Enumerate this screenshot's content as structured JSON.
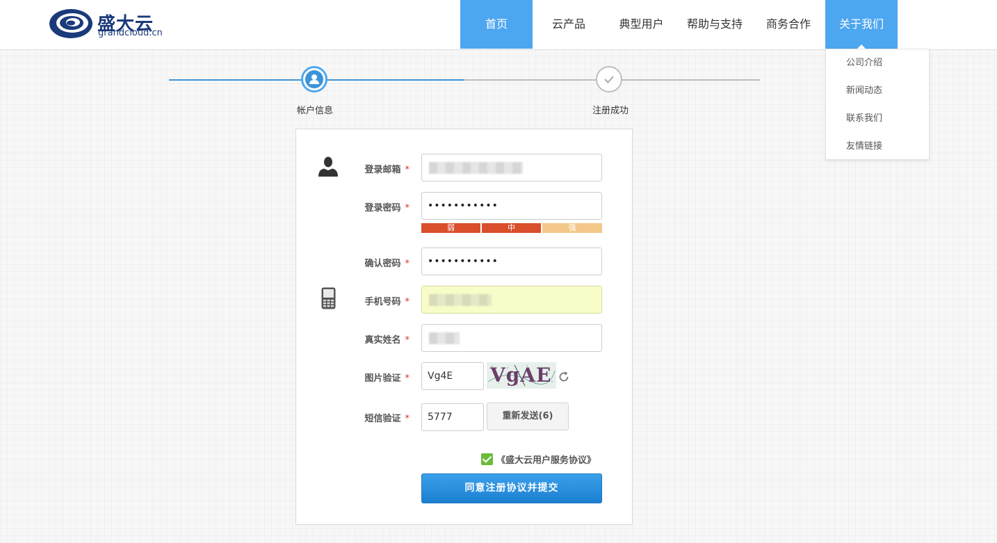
{
  "logo": {
    "title": "盛大云",
    "subtitle": "grandcloud.cn"
  },
  "nav": {
    "items": [
      "首页",
      "云产品",
      "典型用户",
      "帮助与支持",
      "商务合作",
      "关于我们"
    ],
    "active_color": "#4da6f0"
  },
  "dropdown": {
    "items": [
      "公司介绍",
      "新闻动态",
      "联系我们",
      "友情链接"
    ]
  },
  "steps": {
    "step1": "帐户信息",
    "step2": "注册成功",
    "done_color": "#3b94d9",
    "todo_color": "#bdbdbd"
  },
  "form": {
    "required_mark": "*",
    "email_label": "登录邮箱",
    "password_label": "登录密码",
    "password_value": "•••••••••••",
    "strength": {
      "weak": "弱",
      "medium": "中",
      "strong": "强",
      "level": "medium"
    },
    "confirm_label": "确认密码",
    "confirm_value": "•••••••••••",
    "phone_label": "手机号码",
    "name_label": "真实姓名",
    "captcha_label": "图片验证",
    "captcha_value": "Vg4E",
    "captcha_image_text": "VgAE",
    "sms_label": "短信验证",
    "sms_value": "5777",
    "resend_label": "重新发送(6)",
    "agreement_label": "《盛大云用户服务协议》",
    "submit_label": "同意注册协议并提交"
  },
  "colors": {
    "strength_filled": "#d94e2b",
    "strength_empty": "#f3c889",
    "required": "#d9302c",
    "checkbox": "#6cbb3c"
  }
}
